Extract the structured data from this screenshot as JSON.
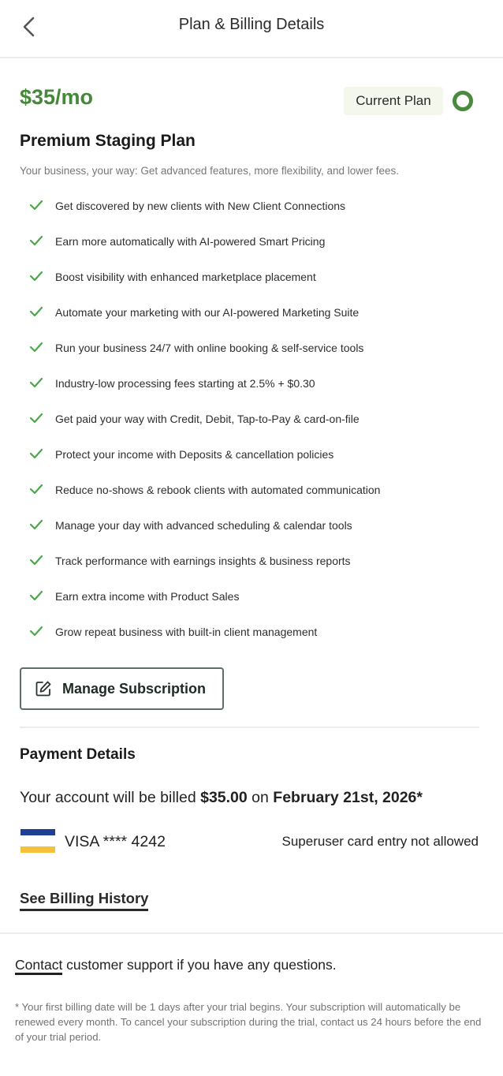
{
  "header": {
    "title": "Plan & Billing Details"
  },
  "plan": {
    "price": "$35/mo",
    "current_label": "Current Plan",
    "name": "Premium Staging Plan",
    "description": "Your business, your way: Get advanced features, more flexibility, and lower fees.",
    "features": [
      "Get discovered by new clients with New Client Connections",
      "Earn more automatically with AI-powered Smart Pricing",
      "Boost visibility with enhanced marketplace placement",
      "Automate your marketing with our AI-powered Marketing Suite",
      "Run your business 24/7 with online booking & self-service tools",
      "Industry-low processing fees starting at 2.5% + $0.30",
      "Get paid your way with Credit, Debit, Tap-to-Pay & card-on-file",
      "Protect your income with Deposits & cancellation policies",
      "Reduce no-shows & rebook clients with automated communication",
      "Manage your day with advanced scheduling & calendar tools",
      "Track performance with earnings insights & business reports",
      "Earn extra income with Product Sales",
      "Grow repeat business with built-in client management"
    ],
    "manage_label": "Manage Subscription"
  },
  "payment": {
    "title": "Payment Details",
    "billed_prefix": "Your account will be billed",
    "billed_amount": "$35.00",
    "billed_on": "on",
    "billed_date": "February 21st, 2026*",
    "card_text": "VISA **** 4242",
    "card_note": "Superuser card entry not allowed",
    "history_label": "See Billing History"
  },
  "footer": {
    "contact_label": "Contact",
    "support_text": " customer support if you have any questions.",
    "footnote": "* Your first billing date will be 1 days after your trial begins. Your subscription will automatically be renewed every month. To cancel your subscription during the trial, contact us 24 hours before the end of your trial period."
  },
  "colors": {
    "accent_green": "#46883a",
    "check_green": "#4aa84a",
    "current_plan_bg": "#f3f7ec",
    "visa_blue": "#1f3f93",
    "visa_yellow": "#f5c13a"
  },
  "icons": {
    "back": "chevron-left-icon",
    "check": "check-icon",
    "edit": "edit-icon",
    "card": "visa-card-icon",
    "radio": "radio-selected-icon"
  }
}
